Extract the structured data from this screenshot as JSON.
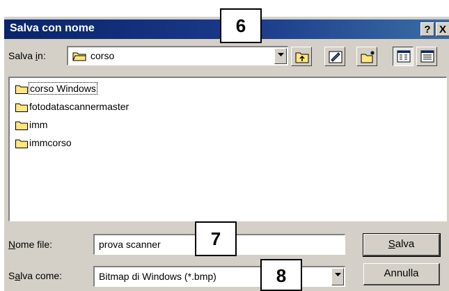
{
  "window": {
    "title": "Salva con nome",
    "help_label": "?",
    "close_label": "X"
  },
  "location": {
    "label_pre": "Salva ",
    "label_accel": "i",
    "label_post": "n:",
    "current_folder": "corso"
  },
  "toolbar": {
    "buttons": [
      "up-one-level",
      "desktop",
      "new-folder",
      "list-view",
      "details-view"
    ]
  },
  "files": [
    {
      "name": "corso Windows",
      "type": "folder",
      "focused": true
    },
    {
      "name": "fotodatascannermaster",
      "type": "folder"
    },
    {
      "name": "imm",
      "type": "folder"
    },
    {
      "name": "immcorso",
      "type": "folder"
    }
  ],
  "filename": {
    "label_accel": "N",
    "label_post": "ome file:",
    "value": "prova scanner"
  },
  "filetype": {
    "label_pre": "S",
    "label_accel": "a",
    "label_post": "lva come:",
    "value": "Bitmap di Windows (*.bmp)"
  },
  "buttons": {
    "save_accel": "S",
    "save_rest": "alva",
    "cancel": "Annulla"
  },
  "callouts": [
    "6",
    "7",
    "8"
  ],
  "colors": {
    "titlebar_start": "#0a246a",
    "titlebar_end": "#3a6ea5",
    "dialog_face": "#d4d0c8",
    "folder": "#ffe680"
  }
}
